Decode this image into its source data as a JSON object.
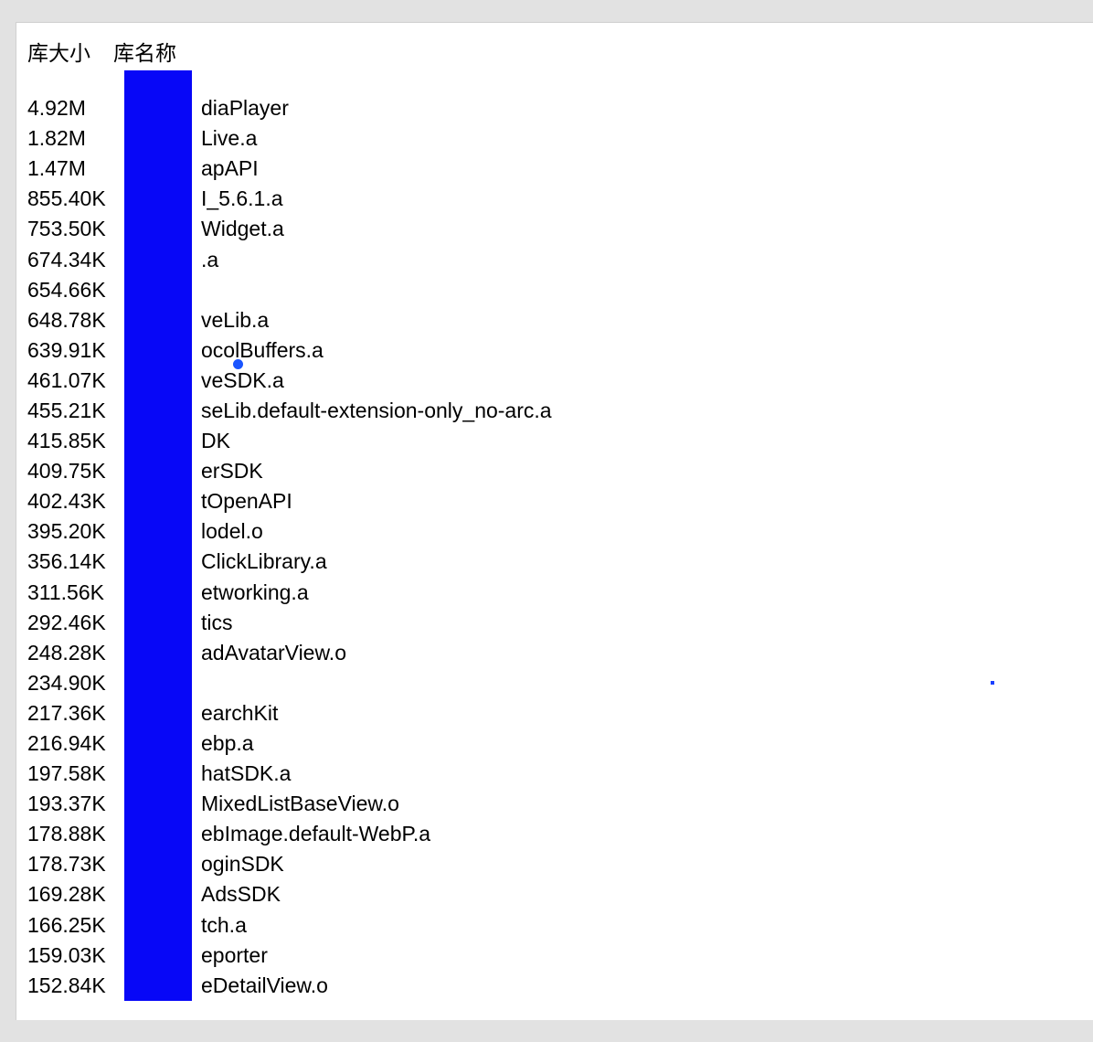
{
  "headers": {
    "size": "库大小",
    "name": "库名称"
  },
  "rows": [
    {
      "size": "4.92M",
      "name": "diaPlayer"
    },
    {
      "size": "1.82M",
      "name": "Live.a"
    },
    {
      "size": "1.47M",
      "name": "apAPI"
    },
    {
      "size": "855.40K",
      "name": "I_5.6.1.a"
    },
    {
      "size": "753.50K",
      "name": "Widget.a"
    },
    {
      "size": "674.34K",
      "name": ".a"
    },
    {
      "size": "654.66K",
      "name": ""
    },
    {
      "size": "648.78K",
      "name": "veLib.a"
    },
    {
      "size": "639.91K",
      "name": "ocolBuffers.a"
    },
    {
      "size": "461.07K",
      "name": "veSDK.a"
    },
    {
      "size": "455.21K",
      "name": "seLib.default-extension-only_no-arc.a"
    },
    {
      "size": "415.85K",
      "name": "DK"
    },
    {
      "size": "409.75K",
      "name": "erSDK"
    },
    {
      "size": "402.43K",
      "name": "tOpenAPI"
    },
    {
      "size": "395.20K",
      "name": "lodel.o"
    },
    {
      "size": "356.14K",
      "name": "ClickLibrary.a"
    },
    {
      "size": "311.56K",
      "name": "etworking.a"
    },
    {
      "size": "292.46K",
      "name": "tics"
    },
    {
      "size": "248.28K",
      "name": "adAvatarView.o"
    },
    {
      "size": "234.90K",
      "name": ""
    },
    {
      "size": "217.36K",
      "name": "earchKit"
    },
    {
      "size": "216.94K",
      "name": "ebp.a"
    },
    {
      "size": "197.58K",
      "name": "hatSDK.a"
    },
    {
      "size": "193.37K",
      "name": "MixedListBaseView.o"
    },
    {
      "size": "178.88K",
      "name": "ebImage.default-WebP.a"
    },
    {
      "size": "178.73K",
      "name": "oginSDK"
    },
    {
      "size": "169.28K",
      "name": "AdsSDK"
    },
    {
      "size": "166.25K",
      "name": "tch.a"
    },
    {
      "size": "159.03K",
      "name": "eporter"
    },
    {
      "size": "152.84K",
      "name": "eDetailView.o"
    }
  ]
}
